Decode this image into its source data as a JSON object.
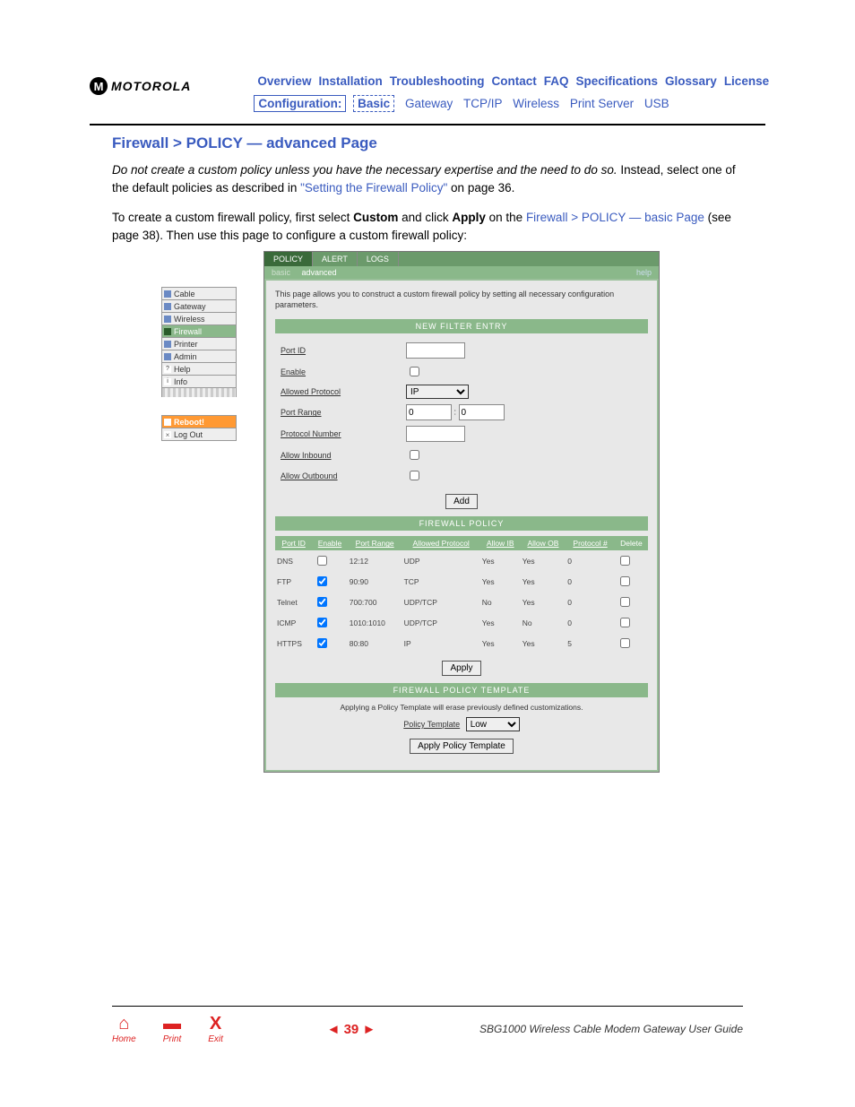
{
  "logo": "MOTOROLA",
  "logo_letter": "M",
  "top_nav": [
    "Overview",
    "Installation",
    "Troubleshooting",
    "Contact",
    "FAQ",
    "Specifications",
    "Glossary",
    "License"
  ],
  "config_label": "Configuration:",
  "config_nav": [
    "Basic",
    "Gateway",
    "TCP/IP",
    "Wireless",
    "Print Server",
    "USB"
  ],
  "title": "Firewall > POLICY — advanced Page",
  "p1_emph": "Do not create a custom policy unless you have the necessary expertise and the need to do so.",
  "p1_rest": " Instead, select one of the default policies as described in ",
  "p1_link": "\"Setting the Firewall Policy\"",
  "p1_tail": " on page 36.",
  "p2_a": "To create a custom firewall policy, first select ",
  "p2_custom": "Custom",
  "p2_b": " and click ",
  "p2_apply": "Apply",
  "p2_c": " on the ",
  "p2_link": "Firewall > POLICY — basic Page",
  "p2_d": " (see page 38). Then use this page to configure a custom firewall policy:",
  "sidenav": [
    "Cable",
    "Gateway",
    "Wireless",
    "Firewall",
    "Printer",
    "Admin",
    "Help",
    "Info"
  ],
  "sidenav_bottom": [
    "Reboot!",
    "Log Out"
  ],
  "tabs": [
    "POLICY",
    "ALERT",
    "LOGS"
  ],
  "subtabs": {
    "basic": "basic",
    "advanced": "advanced",
    "help": "help"
  },
  "panel_desc": "This page allows you to construct a custom firewall policy by setting all necessary configuration parameters.",
  "sections": {
    "new_filter": "NEW FILTER ENTRY",
    "policy": "FIREWALL POLICY",
    "template": "FIREWALL POLICY TEMPLATE"
  },
  "fields": {
    "port_id": "Port ID",
    "enable": "Enable",
    "allowed_protocol": "Allowed Protocol",
    "port_range": "Port Range",
    "protocol_number": "Protocol Number",
    "allow_inbound": "Allow Inbound",
    "allow_outbound": "Allow Outbound"
  },
  "protocol_value": "IP",
  "port_range_a": "0",
  "port_range_b": "0",
  "add_btn": "Add",
  "apply_btn": "Apply",
  "policy_headers": [
    "Port ID",
    "Enable",
    "Port Range",
    "Allowed Protocol",
    "Allow IB",
    "Allow OB",
    "Protocol #",
    "Delete"
  ],
  "policy_rows": [
    {
      "port": "DNS",
      "enable": false,
      "range": "12:12",
      "proto": "UDP",
      "ib": "Yes",
      "ob": "Yes",
      "pn": "0"
    },
    {
      "port": "FTP",
      "enable": true,
      "range": "90:90",
      "proto": "TCP",
      "ib": "Yes",
      "ob": "Yes",
      "pn": "0"
    },
    {
      "port": "Telnet",
      "enable": true,
      "range": "700:700",
      "proto": "UDP/TCP",
      "ib": "No",
      "ob": "Yes",
      "pn": "0"
    },
    {
      "port": "ICMP",
      "enable": true,
      "range": "1010:1010",
      "proto": "UDP/TCP",
      "ib": "Yes",
      "ob": "No",
      "pn": "0"
    },
    {
      "port": "HTTPS",
      "enable": true,
      "range": "80:80",
      "proto": "IP",
      "ib": "Yes",
      "ob": "Yes",
      "pn": "5"
    }
  ],
  "template_note": "Applying a Policy Template will erase previously defined customizations.",
  "template_label": "Policy Template",
  "template_value": "Low",
  "template_btn": "Apply Policy Template",
  "footer": {
    "home": "Home",
    "print": "Print",
    "exit": "Exit",
    "page": "39",
    "guide": "SBG1000 Wireless Cable Modem Gateway User Guide"
  }
}
